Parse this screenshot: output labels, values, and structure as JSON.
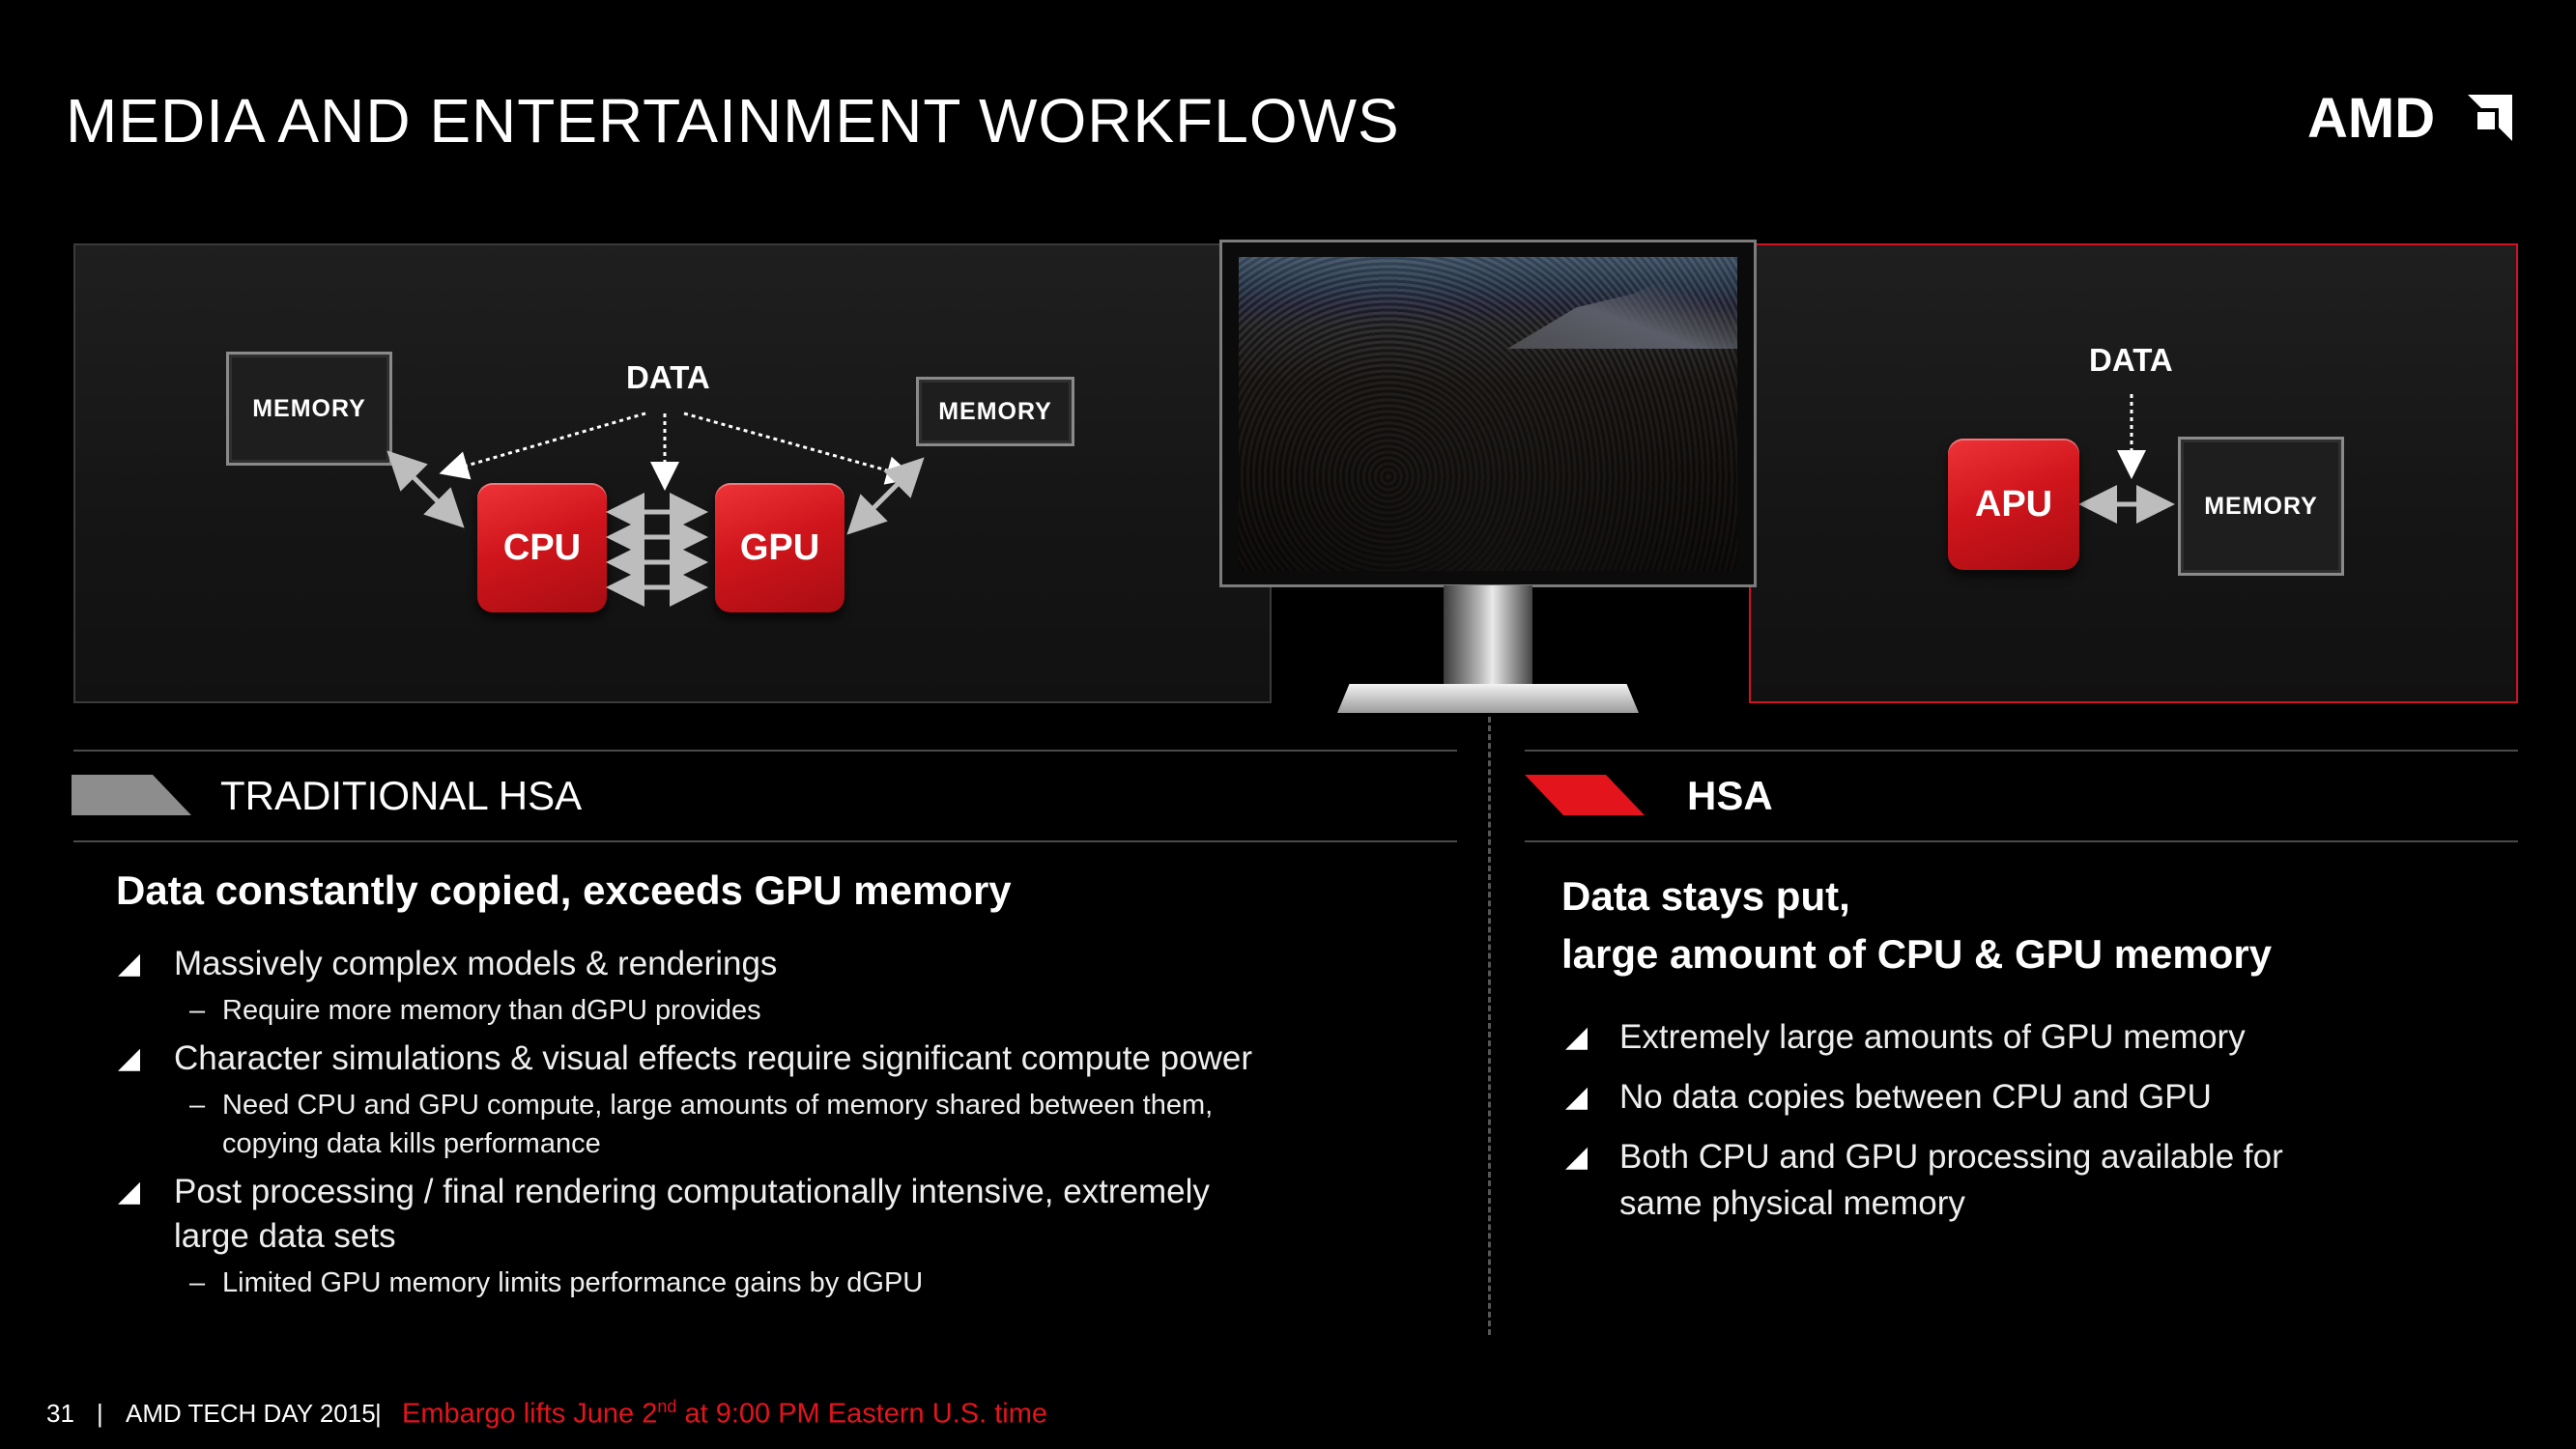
{
  "slide": {
    "title": "MEDIA AND ENTERTAINMENT WORKFLOWS",
    "logo": "AMD"
  },
  "diagram_left": {
    "data_label": "DATA",
    "memory_left": "MEMORY",
    "memory_right": "MEMORY",
    "cpu": "CPU",
    "gpu": "GPU"
  },
  "diagram_right": {
    "data_label": "DATA",
    "apu": "APU",
    "memory": "MEMORY"
  },
  "left_section": {
    "label": "TRADITIONAL HSA",
    "headline": "Data constantly copied, exceeds GPU memory",
    "bullets": [
      {
        "text": "Massively complex models & renderings",
        "subs": [
          "Require more memory than dGPU provides"
        ]
      },
      {
        "text": "Character simulations & visual effects require significant compute power",
        "subs": [
          "Need CPU and GPU compute, large amounts of memory shared between them,",
          "copying data kills performance"
        ]
      },
      {
        "text": "Post processing / final rendering computationally intensive, extremely",
        "text2": "large data sets",
        "subs": [
          "Limited GPU memory limits performance gains by dGPU"
        ]
      }
    ]
  },
  "right_section": {
    "label": "HSA",
    "headline_1": "Data stays put,",
    "headline_2": "large amount of CPU & GPU memory",
    "bullets": [
      "Extremely large amounts of GPU memory",
      "No data copies between CPU and GPU",
      "Both CPU and GPU processing available for",
      "same physical memory"
    ]
  },
  "footer": {
    "page": "31",
    "sep": "|",
    "event": "AMD TECH DAY 2015",
    "embargo_pre": "Embargo lifts June 2",
    "embargo_sup": "nd",
    "embargo_post": " at 9:00 PM Eastern U.S. time"
  },
  "colors": {
    "accent_red": "#e4141d",
    "chip_red": "#d0151c",
    "gray": "#8a8a8a"
  },
  "icons": [
    "bullet-triangle-icon",
    "section-gray-parallelogram-icon",
    "section-red-parallelogram-icon",
    "amd-logo-arrow-icon"
  ]
}
